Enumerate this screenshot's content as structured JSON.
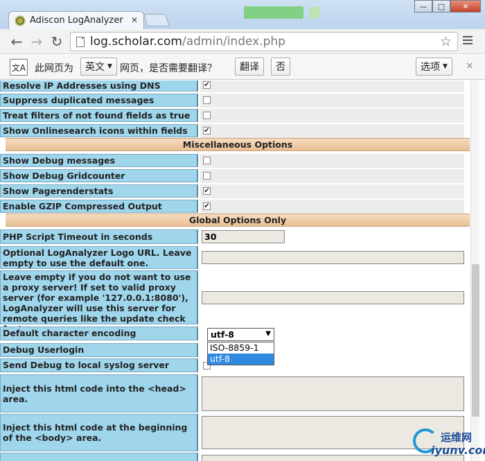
{
  "browser": {
    "tab_title": "Adiscon LogAnalyzer :: A",
    "url_host": "log.scholar.com",
    "url_path": "/admin/index.php",
    "window_minimize": "—",
    "window_maximize": "□",
    "window_close": "✕"
  },
  "translate_bar": {
    "icon_text": "文A",
    "text_before": "此网页为",
    "language": "英文",
    "text_after": "网页，是否需要翻译？",
    "translate_button": "翻译",
    "no_button": "否",
    "options_button": "选项",
    "close": "×"
  },
  "options": {
    "rows_top": [
      {
        "label": "Resolve IP Addresses using DNS",
        "checked": true,
        "mark": "✔"
      },
      {
        "label": "Suppress duplicated messages",
        "checked": false,
        "mark": ""
      },
      {
        "label": "Treat filters of not found fields as true",
        "checked": false,
        "mark": ""
      },
      {
        "label": "Show Onlinesearch icons within fields",
        "checked": true,
        "mark": "✔"
      }
    ],
    "section_misc": "Miscellaneous Options",
    "rows_misc": [
      {
        "label": "Show Debug messages",
        "checked": false,
        "mark": ""
      },
      {
        "label": "Show Debug Gridcounter",
        "checked": false,
        "mark": ""
      },
      {
        "label": "Show Pagerenderstats",
        "checked": true,
        "mark": "✔"
      },
      {
        "label": "Enable GZIP Compressed Output",
        "checked": true,
        "mark": "✔"
      }
    ],
    "section_global": "Global Options Only",
    "php_timeout_label": "PHP Script Timeout in seconds",
    "php_timeout_value": "30",
    "logo_url_label": "Optional LogAnalyzer Logo URL. Leave empty to use the default one.",
    "proxy_label": "Leave empty if you do not want to use a proxy server! If set to valid proxy server (for example '127.0.0.1:8080'), LogAnalyzer will use this server for remote queries like the update check feature.",
    "encoding_label": "Default character encoding",
    "encoding_value": "utf-8",
    "encoding_options": [
      "ISO-8859-1",
      "utf-8"
    ],
    "debug_userlogin_label": "Debug Userlogin",
    "send_debug_label": "Send Debug to local syslog server",
    "inject_head_label": "Inject this html code into the <head> area.",
    "inject_body_label": "Inject this html code at the beginning of the <body> area."
  },
  "watermark": {
    "line1": "运维网",
    "line2": "iyunv.com"
  }
}
